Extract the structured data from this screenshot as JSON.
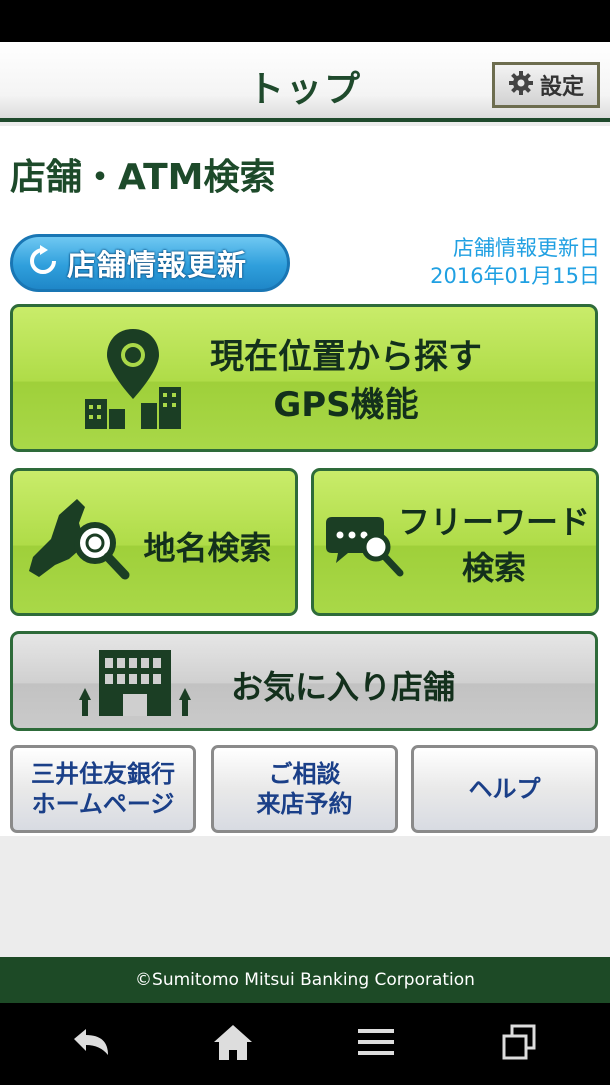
{
  "header": {
    "title": "トップ",
    "settings_label": "設定"
  },
  "page": {
    "heading": "店舗・ATM検索"
  },
  "refresh": {
    "label": "店舗情報更新"
  },
  "update_info": {
    "label": "店舗情報更新日",
    "date": "2016年01月15日"
  },
  "tiles": {
    "gps": {
      "line1": "現在位置から探す",
      "line2": "GPS機能"
    },
    "place": {
      "label": "地名検索"
    },
    "freeword": {
      "line1": "フリーワード",
      "line2": "検索"
    },
    "favorites": {
      "label": "お気に入り店舗"
    }
  },
  "bottom_buttons": [
    {
      "label": "三井住友銀行\nホームページ"
    },
    {
      "label": "ご相談\n来店予約"
    },
    {
      "label": "ヘルプ"
    }
  ],
  "footer": {
    "copyright": "©Sumitomo Mitsui Banking Corporation"
  },
  "colors": {
    "brand_green": "#1d4a26",
    "tile_green": "#afdc48",
    "accent_blue": "#20a0e2"
  },
  "icons": [
    "gear-icon",
    "refresh-icon",
    "gps-pin-icon",
    "map-search-icon",
    "chat-search-icon",
    "building-icon",
    "back-icon",
    "home-icon",
    "menu-icon",
    "recent-apps-icon"
  ]
}
